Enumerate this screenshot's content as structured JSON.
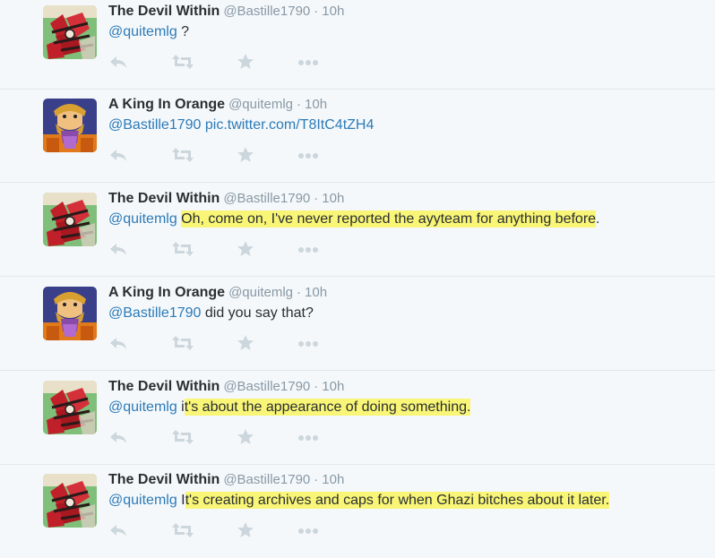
{
  "colors": {
    "accent": "#2b7bb9",
    "muted": "#8899a6",
    "icon": "#ccd6dd",
    "highlight": "#f9f576",
    "background": "#f5f8fa"
  },
  "icons": {
    "reply": "reply-icon",
    "retweet": "retweet-icon",
    "favorite": "star-icon",
    "more": "more-icon"
  },
  "tweets": [
    {
      "fullname": "The Devil Within",
      "username": "@Bastille1790",
      "sep": "·",
      "time": "10h",
      "mention": "@quitemlg",
      "text_plain": " ?",
      "text_hl": ""
    },
    {
      "fullname": "A King In Orange",
      "username": "@quitemlg",
      "sep": "·",
      "time": "10h",
      "mention": "@Bastille1790",
      "link": "pic.twitter.com/T8ItC4tZH4"
    },
    {
      "fullname": "The Devil Within",
      "username": "@Bastille1790",
      "sep": "·",
      "time": "10h",
      "mention": "@quitemlg",
      "text_hl": "Oh, come on, I've never reported the ayyteam for anything before",
      "text_after": "."
    },
    {
      "fullname": "A King In Orange",
      "username": "@quitemlg",
      "sep": "·",
      "time": "10h",
      "mention": "@Bastille1790",
      "text_plain": " did you say that?"
    },
    {
      "fullname": "The Devil Within",
      "username": "@Bastille1790",
      "sep": "·",
      "time": "10h",
      "mention": "@quitemlg",
      "text_before": " i",
      "text_hl": "t's about the appearance of doing something."
    },
    {
      "fullname": "The Devil Within",
      "username": "@Bastille1790",
      "sep": "·",
      "time": "10h",
      "mention": "@quitemlg",
      "text_before": " I",
      "text_hl": "t's creating archives and caps for when Ghazi bitches about it later."
    }
  ]
}
